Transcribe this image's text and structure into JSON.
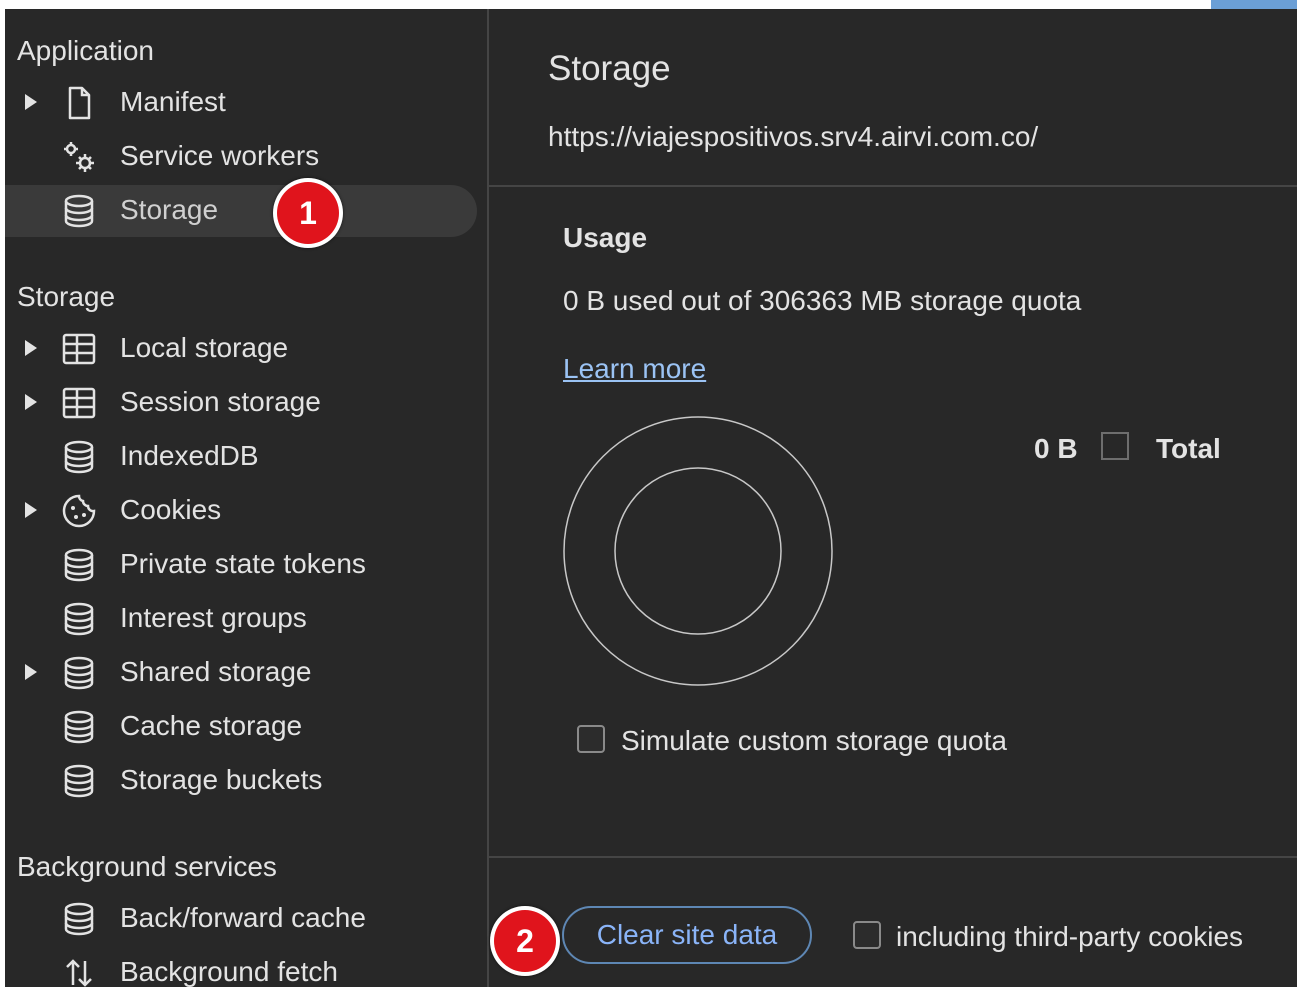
{
  "sidebar": {
    "application_title": "Application",
    "application_items": [
      {
        "label": "Manifest",
        "icon": "file-icon",
        "expandable": true
      },
      {
        "label": "Service workers",
        "icon": "gears-icon",
        "expandable": false
      },
      {
        "label": "Storage",
        "icon": "database-icon",
        "expandable": false,
        "selected": true
      }
    ],
    "storage_title": "Storage",
    "storage_items": [
      {
        "label": "Local storage",
        "icon": "table-icon",
        "expandable": true
      },
      {
        "label": "Session storage",
        "icon": "table-icon",
        "expandable": true
      },
      {
        "label": "IndexedDB",
        "icon": "database-icon",
        "expandable": false
      },
      {
        "label": "Cookies",
        "icon": "cookie-icon",
        "expandable": true
      },
      {
        "label": "Private state tokens",
        "icon": "database-icon",
        "expandable": false
      },
      {
        "label": "Interest groups",
        "icon": "database-icon",
        "expandable": false
      },
      {
        "label": "Shared storage",
        "icon": "database-icon",
        "expandable": true
      },
      {
        "label": "Cache storage",
        "icon": "database-icon",
        "expandable": false
      },
      {
        "label": "Storage buckets",
        "icon": "database-icon",
        "expandable": false
      }
    ],
    "background_title": "Background services",
    "background_items": [
      {
        "label": "Back/forward cache",
        "icon": "database-icon",
        "expandable": false
      },
      {
        "label": "Background fetch",
        "icon": "sync-arrows-icon",
        "expandable": false
      }
    ]
  },
  "main": {
    "title": "Storage",
    "origin_url": "https://viajespositivos.srv4.airvi.com.co/",
    "usage_heading": "Usage",
    "usage_text": "0 B used out of 306363 MB storage quota",
    "learn_more": "Learn more",
    "legend_value": "0 B",
    "legend_label": "Total",
    "simulate_quota_label": "Simulate custom storage quota",
    "clear_button": "Clear site data",
    "third_party_label": "including third-party cookies"
  },
  "callouts": {
    "one": "1",
    "two": "2"
  },
  "colors": {
    "background": "#282828",
    "selected_row": "#3a3a3a",
    "accent": "#8ab4f8",
    "callout_red": "#e0141c"
  }
}
